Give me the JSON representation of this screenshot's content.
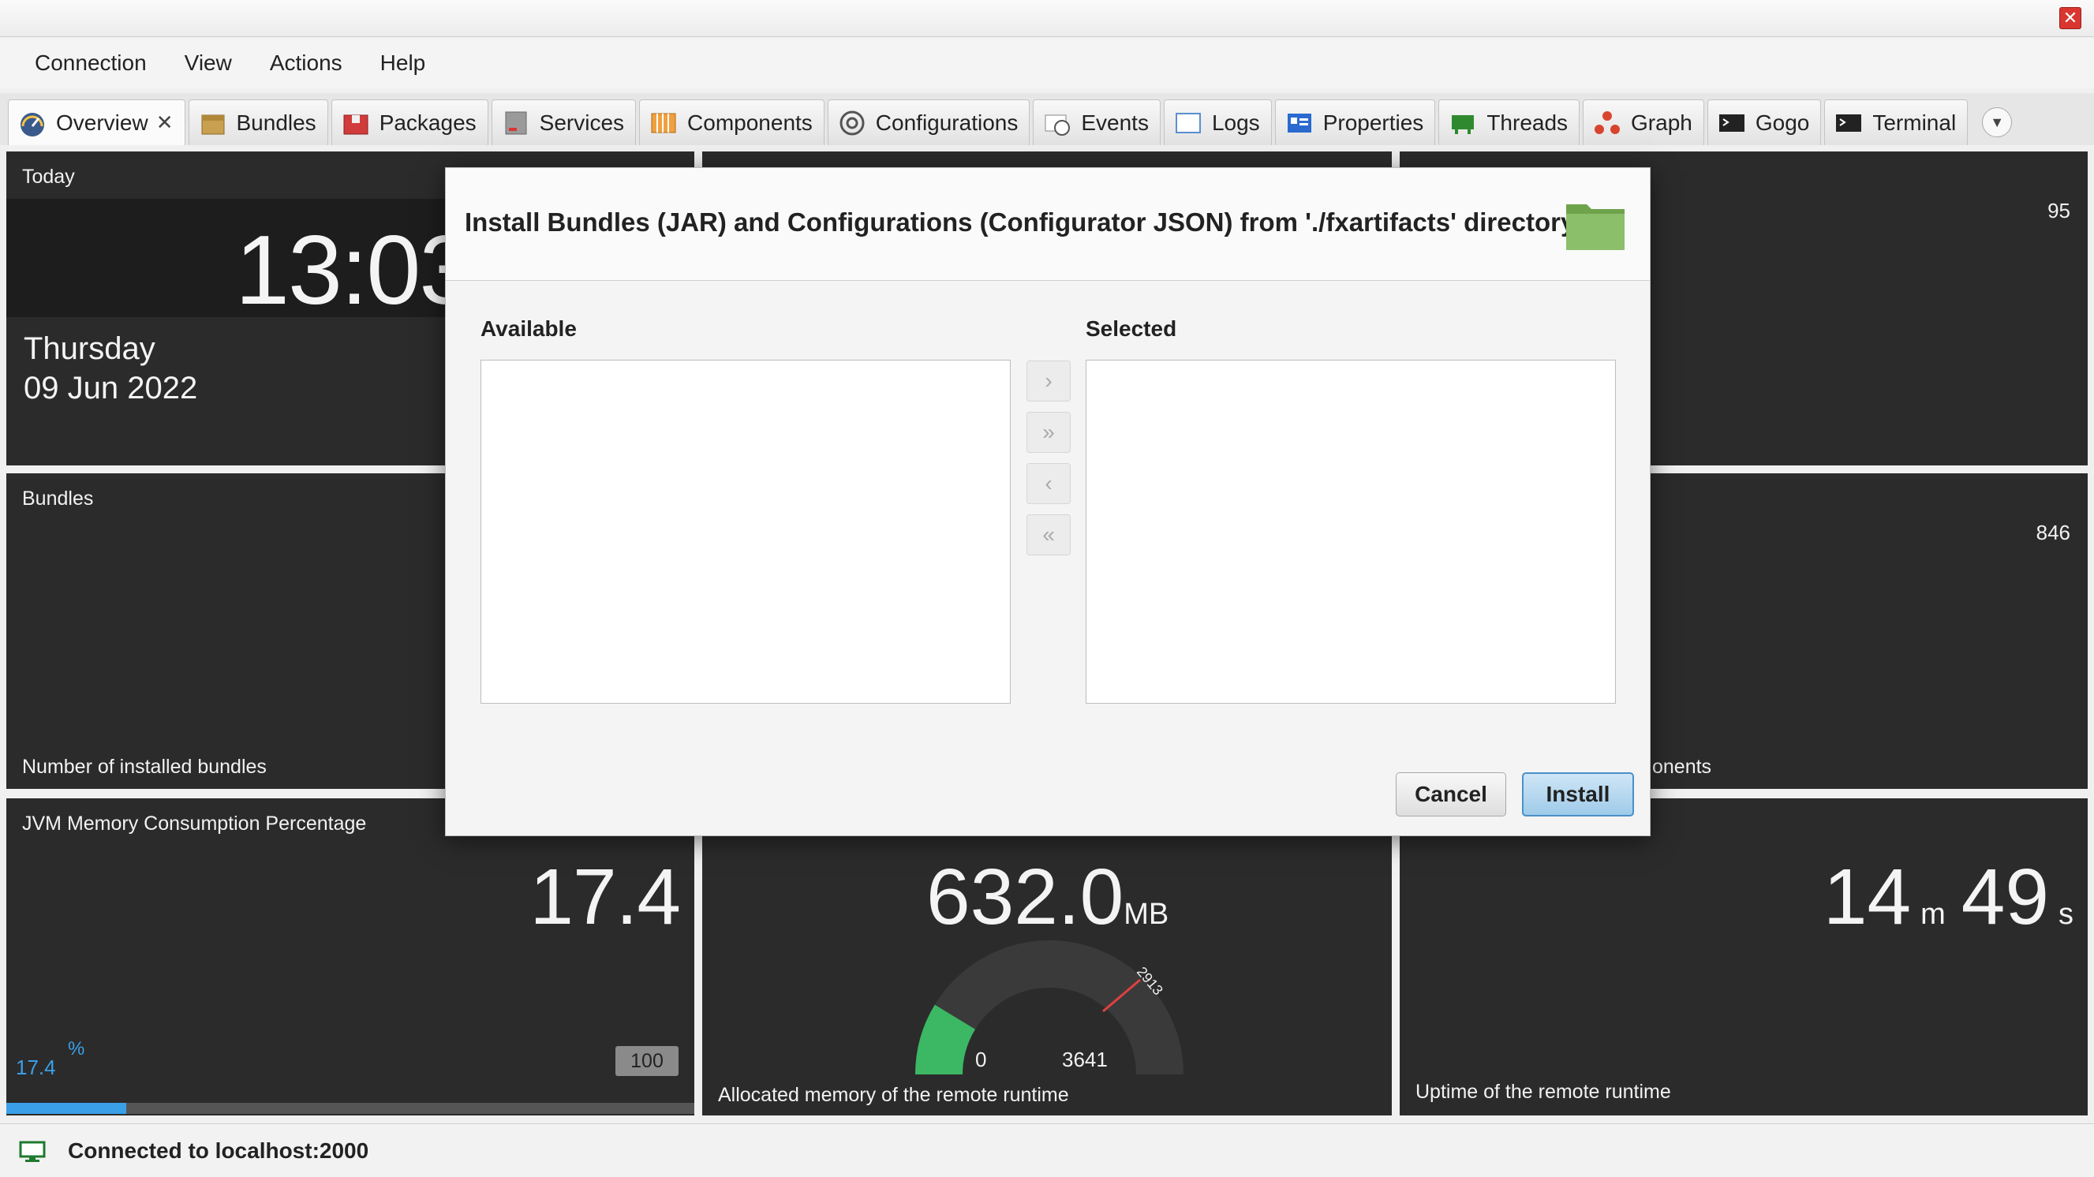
{
  "window": {
    "close_glyph": "✕"
  },
  "menu": [
    "Connection",
    "View",
    "Actions",
    "Help"
  ],
  "tabs": [
    {
      "label": "Overview",
      "icon": "gauge-icon",
      "active": true,
      "closable": true
    },
    {
      "label": "Bundles",
      "icon": "box-icon"
    },
    {
      "label": "Packages",
      "icon": "package-icon"
    },
    {
      "label": "Services",
      "icon": "server-icon"
    },
    {
      "label": "Components",
      "icon": "components-icon"
    },
    {
      "label": "Configurations",
      "icon": "gear-icon"
    },
    {
      "label": "Events",
      "icon": "events-icon"
    },
    {
      "label": "Logs",
      "icon": "logs-icon"
    },
    {
      "label": "Properties",
      "icon": "properties-icon"
    },
    {
      "label": "Threads",
      "icon": "threads-icon"
    },
    {
      "label": "Graph",
      "icon": "graph-icon"
    },
    {
      "label": "Gogo",
      "icon": "console-icon"
    },
    {
      "label": "Terminal",
      "icon": "terminal-icon"
    }
  ],
  "tab_close_glyph": "✕",
  "tab_overflow_glyph": "▼",
  "tiles": {
    "today": {
      "title": "Today",
      "time": "13:03",
      "day": "Thursday",
      "date": "09 Jun 2022"
    },
    "top_right": {
      "value": "95"
    },
    "bundles": {
      "title": "Bundles",
      "subtitle": "Number of installed bundles"
    },
    "components": {
      "value": "846",
      "subtitle": "onents"
    },
    "jvm": {
      "title": "JVM Memory Consumption Percentage",
      "value": "17.4",
      "current": "17.4",
      "unit": "%",
      "max": "100",
      "progress_fraction": 0.174
    },
    "memory": {
      "value": "632.0",
      "unit": "MB",
      "gauge_min": "0",
      "gauge_max": "3641",
      "gauge_marker": "2913",
      "subtitle": "Allocated memory of the remote runtime",
      "gauge_fraction": 0.174
    },
    "uptime": {
      "minutes": "14",
      "minutes_unit": "m",
      "seconds": "49",
      "seconds_unit": "s",
      "subtitle": "Uptime of the remote runtime"
    }
  },
  "dialog": {
    "title": "Install Bundles (JAR) and Configurations (Configurator JSON) from './fxartifacts' directory",
    "available_label": "Available",
    "selected_label": "Selected",
    "move_buttons": [
      "›",
      "»",
      "‹",
      "«"
    ],
    "cancel_label": "Cancel",
    "install_label": "Install"
  },
  "status": {
    "text": "Connected to localhost:2000"
  },
  "colors": {
    "tile_bg": "#2b2b2b",
    "accent_blue": "#3aa0e8",
    "gauge_green": "#3cb763",
    "gauge_marker": "#e04040",
    "folder_green": "#8bbf6a"
  }
}
